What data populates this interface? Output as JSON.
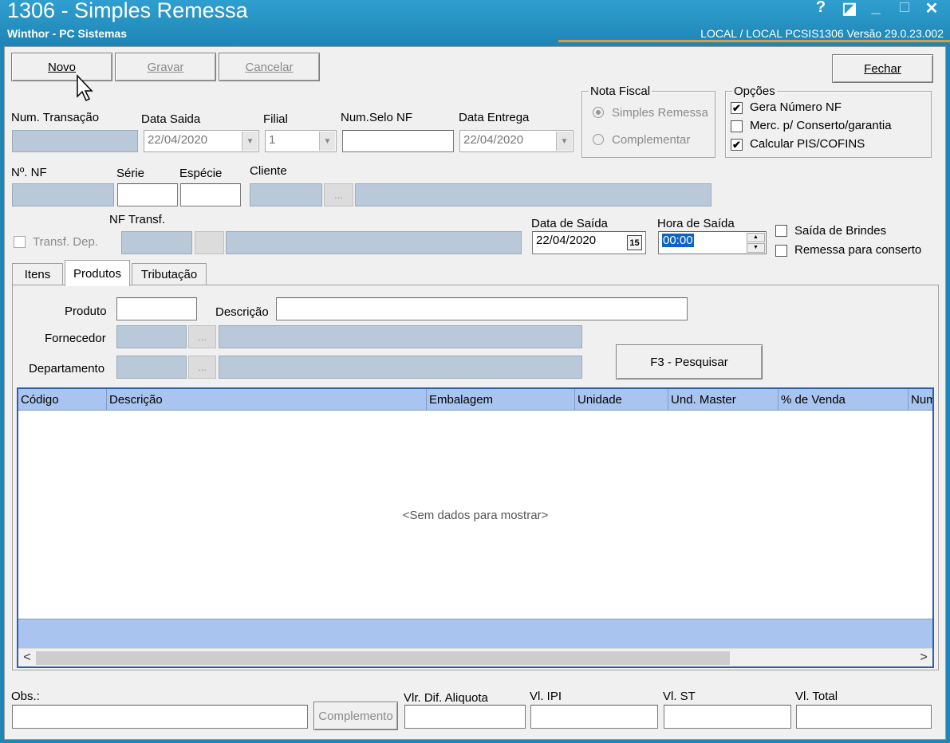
{
  "window": {
    "title": "1306 - Simples Remessa",
    "company": "Winthor - PC Sistemas",
    "status": "LOCAL / LOCAL   PCSIS1306  Versão  29.0.23.002",
    "help": "?",
    "restore": "◪",
    "minimize": "_",
    "maximize": "□",
    "close": "✕"
  },
  "toolbar": {
    "novo": "Novo",
    "gravar": "Gravar",
    "cancelar": "Cancelar",
    "fechar": "Fechar"
  },
  "header": {
    "num_transacao_label": "Num. Transação",
    "num_transacao_value": "",
    "data_saida_label": "Data Saida",
    "data_saida_value": "22/04/2020",
    "filial_label": "Filial",
    "filial_value": "1",
    "num_selo_label": "Num.Selo NF",
    "num_selo_value": "",
    "data_entrega_label": "Data Entrega",
    "data_entrega_value": "22/04/2020"
  },
  "nota_fiscal": {
    "label": "Nota Fiscal",
    "simples_remessa": "Simples Remessa",
    "complementar": "Complementar"
  },
  "opcoes": {
    "label": "Opções",
    "gera_numero": "Gera Número NF",
    "gera_numero_checked": "✔",
    "merc_conserto": "Merc. p/ Conserto/garantia",
    "merc_conserto_checked": "",
    "calcular_pis": "Calcular PIS/COFINS",
    "calcular_pis_checked": "✔"
  },
  "row2": {
    "num_nf_label": "Nº. NF",
    "serie_label": "Série",
    "especie_label": "Espécie",
    "cliente_label": "Cliente",
    "ellipsis": "..."
  },
  "row3": {
    "transf_dep": "Transf. Dep.",
    "nf_transf_label": "NF Transf.",
    "data_saida_label": "Data de Saída",
    "data_saida_value": "22/04/2020",
    "calendar": "15",
    "hora_saida_label": "Hora de Saída",
    "hora_saida_value": "00:00",
    "saida_brindes": "Saída de Brindes",
    "remessa_conserto": "Remessa para conserto"
  },
  "tabs": {
    "itens": "Itens",
    "produtos": "Produtos",
    "tributacao": "Tributação"
  },
  "produtos": {
    "produto_label": "Produto",
    "descricao_label": "Descrição",
    "fornecedor_label": "Fornecedor",
    "departamento_label": "Departamento",
    "pesquisar": "F3 - Pesquisar"
  },
  "grid": {
    "columns": [
      "Código",
      "Descrição",
      "Embalagem",
      "Unidade",
      "Und. Master",
      "% de Venda",
      "Num"
    ],
    "empty": "<Sem dados para mostrar>",
    "left_arrow": "<",
    "right_arrow": ">"
  },
  "footer": {
    "obs_label": "Obs.:",
    "complemento": "Complemento",
    "vlr_dif_label": "Vlr. Dif. Aliquota",
    "vl_ipi_label": "Vl. IPI",
    "vl_st_label": "Vl. ST",
    "vl_total_label": "Vl. Total"
  }
}
